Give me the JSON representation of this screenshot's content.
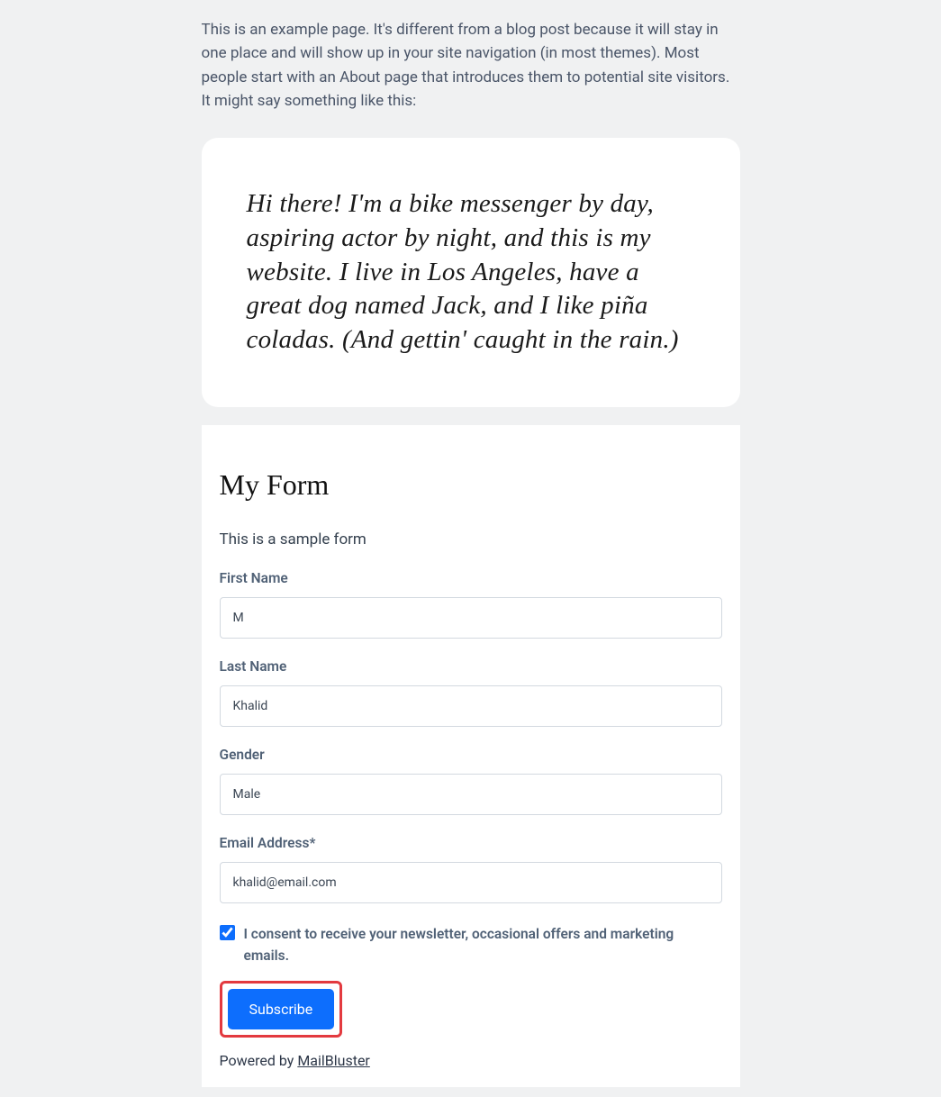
{
  "intro": "This is an example page. It's different from a blog post because it will stay in one place and will show up in your site navigation (in most themes). Most people start with an About page that introduces them to potential site visitors. It might say something like this:",
  "quote": "Hi there! I'm a bike messenger by day, aspiring actor by night, and this is my website. I live in Los Angeles, have a great dog named Jack, and I like piña coladas. (And gettin' caught in the rain.)",
  "form": {
    "title": "My Form",
    "desc": "This is a sample form",
    "fields": {
      "first_name": {
        "label": "First Name",
        "value": "M"
      },
      "last_name": {
        "label": "Last Name",
        "value": "Khalid"
      },
      "gender": {
        "label": "Gender",
        "value": "Male"
      },
      "email": {
        "label": "Email Address*",
        "value": "khalid@email.com"
      }
    },
    "consent": {
      "text": "I consent to receive your newsletter, occasional offers and marketing emails.",
      "checked": true
    },
    "subscribe_label": "Subscribe",
    "powered_prefix": "Powered by ",
    "powered_link": "MailBluster"
  }
}
